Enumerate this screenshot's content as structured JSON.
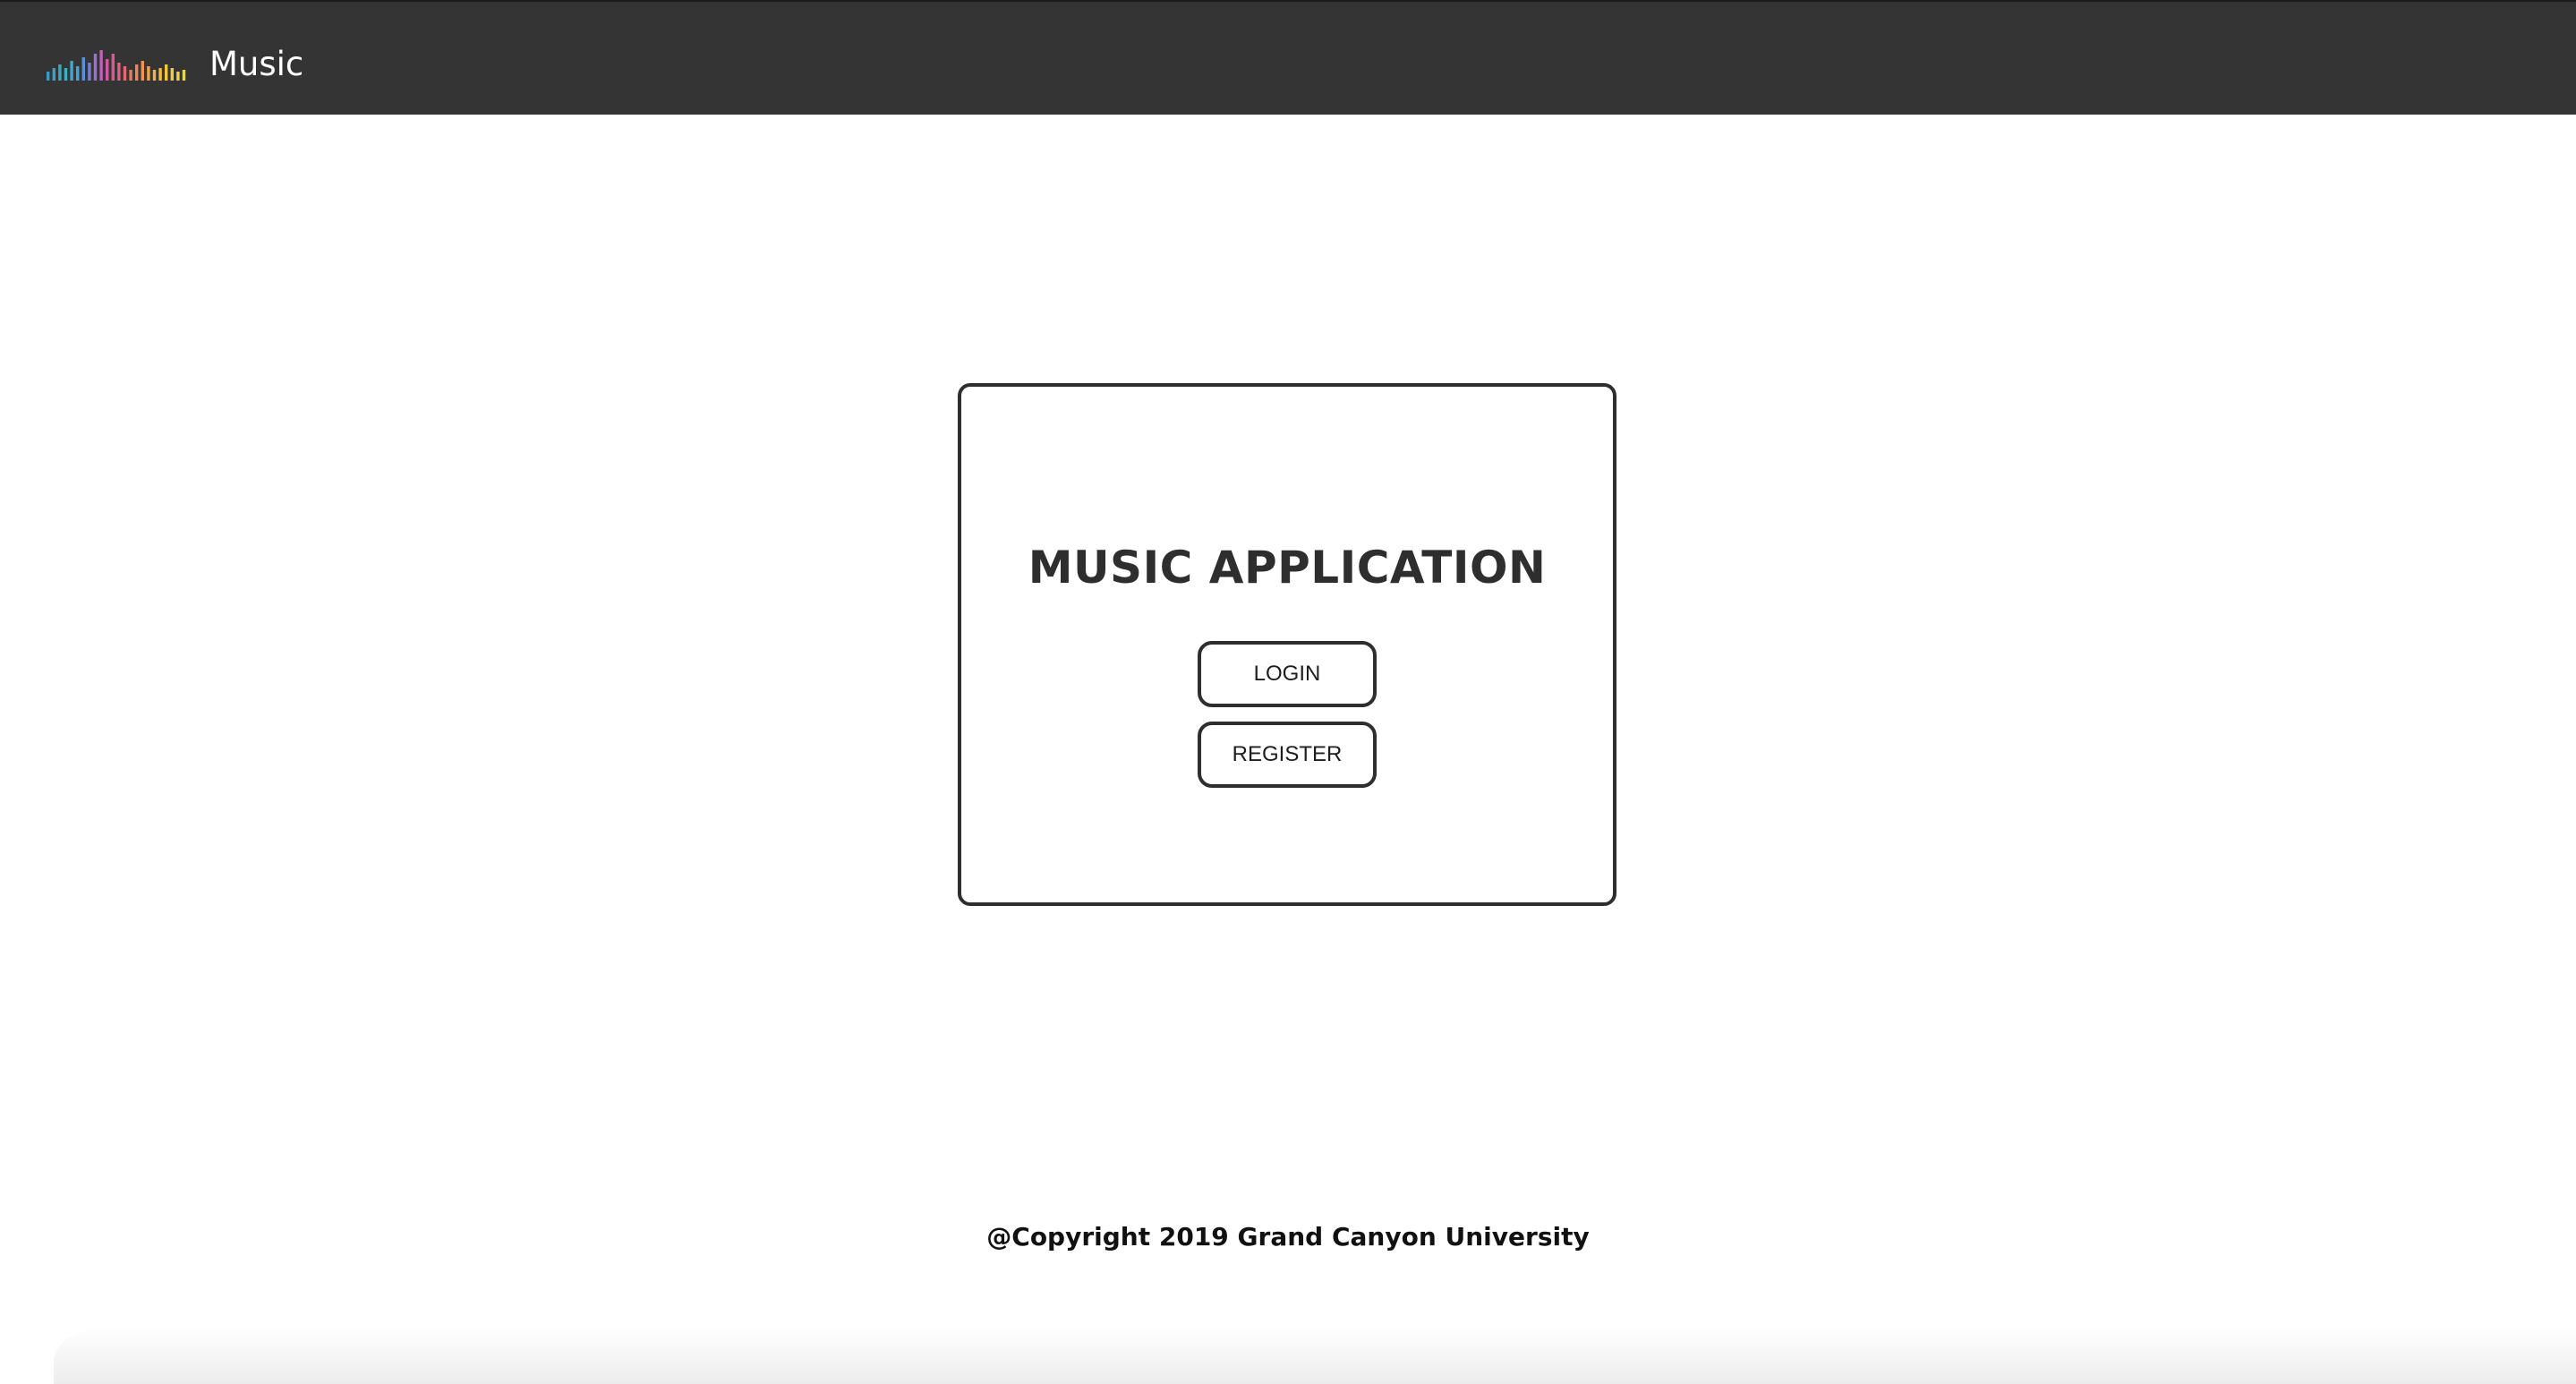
{
  "navbar": {
    "brand_label": "Music",
    "logo_icon": "equalizer-bars-icon"
  },
  "card": {
    "title": "MUSIC APPLICATION",
    "login_label": "LOGIN",
    "register_label": "REGISTER"
  },
  "footer": {
    "copyright": "@Copyright 2019 Grand Canyon University"
  },
  "colors": {
    "navbar_bg": "#343434",
    "card_border": "#2e2e2e",
    "page_bg": "#ffffff"
  }
}
